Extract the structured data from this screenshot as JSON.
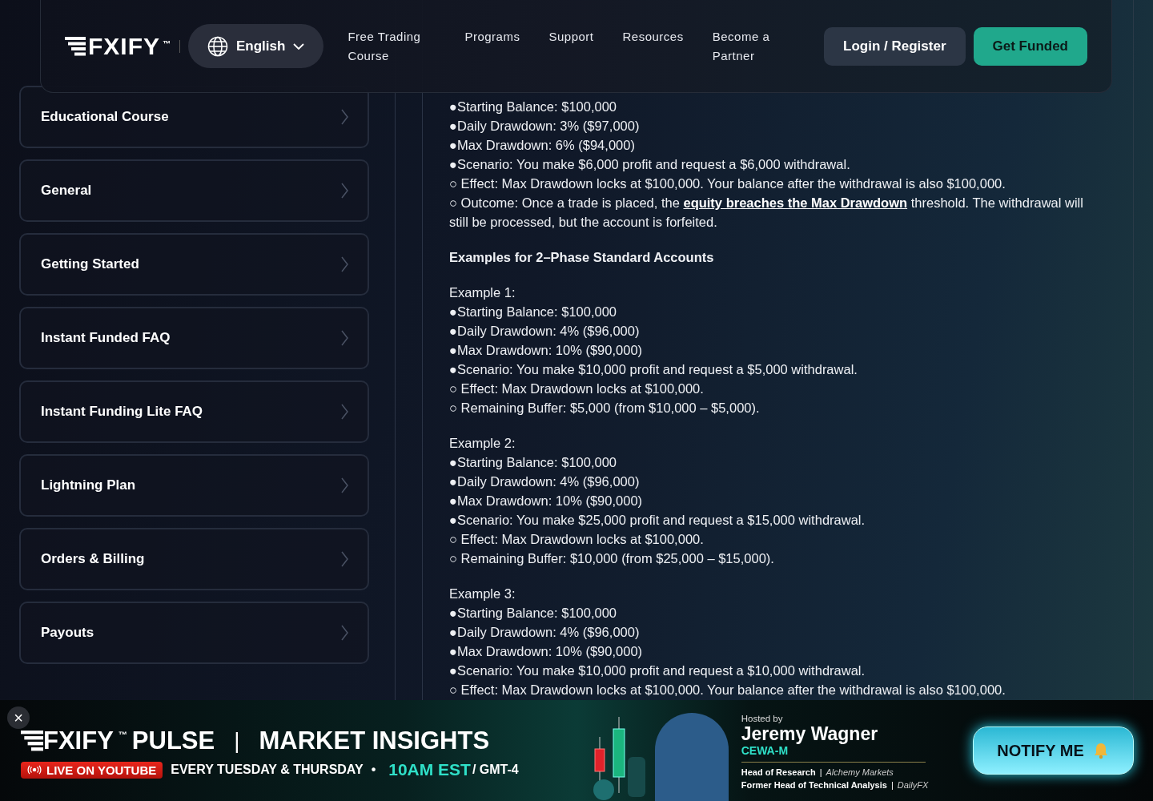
{
  "header": {
    "logo": "FXIFY",
    "logo_mark": "™",
    "language": "English",
    "nav": [
      "Free Trading Course",
      "Programs",
      "Support",
      "Resources",
      "Become a Partner"
    ],
    "login": "Login / Register",
    "cta": "Get Funded"
  },
  "sidebar": {
    "items": [
      "Educational Course",
      "General",
      "Getting Started",
      "Instant Funded FAQ",
      "Instant Funding Lite FAQ",
      "Lightning Plan",
      "Orders & Billing",
      "Payouts"
    ]
  },
  "article": {
    "blocks": [
      {
        "kind": "list",
        "lines": [
          {
            "text": "●Starting Balance: $100,000"
          },
          {
            "text": "●Daily Drawdown: 3% ($97,000)"
          },
          {
            "text": "●Max Drawdown: 6% ($94,000)"
          },
          {
            "text": "●Scenario: You make $6,000 profit and request a $6,000 withdrawal."
          },
          {
            "text": "○ Effect: Max Drawdown locks at $100,000. Your balance after the withdrawal is also $100,000."
          },
          {
            "text": "○ Outcome: Once a trade is placed, the ",
            "link": "equity breaches the Max Drawdown",
            "after": " threshold. The withdrawal will still be processed, but the account is forfeited."
          }
        ]
      },
      {
        "kind": "heading",
        "text": "Examples for 2–Phase Standard Accounts"
      },
      {
        "kind": "list",
        "lines": [
          {
            "text": "Example 1:"
          },
          {
            "text": "●Starting Balance: $100,000"
          },
          {
            "text": "●Daily Drawdown: 4% ($96,000)"
          },
          {
            "text": "●Max Drawdown: 10% ($90,000)"
          },
          {
            "text": "●Scenario: You make $10,000 profit and request a $5,000 withdrawal."
          },
          {
            "text": "○ Effect: Max Drawdown locks at $100,000."
          },
          {
            "text": "○ Remaining Buffer: $5,000 (from $10,000 – $5,000)."
          }
        ]
      },
      {
        "kind": "list",
        "lines": [
          {
            "text": "Example 2:"
          },
          {
            "text": "●Starting Balance: $100,000"
          },
          {
            "text": "●Daily Drawdown: 4% ($96,000)"
          },
          {
            "text": "●Max Drawdown: 10% ($90,000)"
          },
          {
            "text": "●Scenario: You make $25,000 profit and request a $15,000 withdrawal."
          },
          {
            "text": "○ Effect: Max Drawdown locks at $100,000."
          },
          {
            "text": "○ Remaining Buffer: $10,000 (from $25,000 – $15,000)."
          }
        ]
      },
      {
        "kind": "list",
        "lines": [
          {
            "text": "Example 3:"
          },
          {
            "text": "●Starting Balance: $100,000"
          },
          {
            "text": "●Daily Drawdown: 4% ($96,000)"
          },
          {
            "text": "●Max Drawdown: 10% ($90,000)"
          },
          {
            "text": "●Scenario: You make $10,000 profit and request a $10,000 withdrawal."
          },
          {
            "text": "○ Effect: Max Drawdown locks at $100,000. Your balance after the withdrawal is also $100,000."
          }
        ]
      }
    ]
  },
  "banner": {
    "close": "×",
    "logo": "FXIFY",
    "logo_mark": "™",
    "product": "PULSE",
    "separator": "|",
    "title": "MARKET INSIGHTS",
    "live": "LIVE ON YOUTUBE",
    "schedule": "EVERY TUESDAY & THURSDAY",
    "bullet": "•",
    "time": "10AM EST",
    "timezone": "/ GMT-4",
    "hosted_by": "Hosted by",
    "host": "Jeremy Wagner",
    "credential": "CEWA-M",
    "roles": [
      {
        "title": "Head of Research",
        "org": "Alchemy Markets"
      },
      {
        "title": "Former Head of Technical Analysis",
        "org": "DailyFX"
      }
    ],
    "button": "NOTIFY ME"
  }
}
